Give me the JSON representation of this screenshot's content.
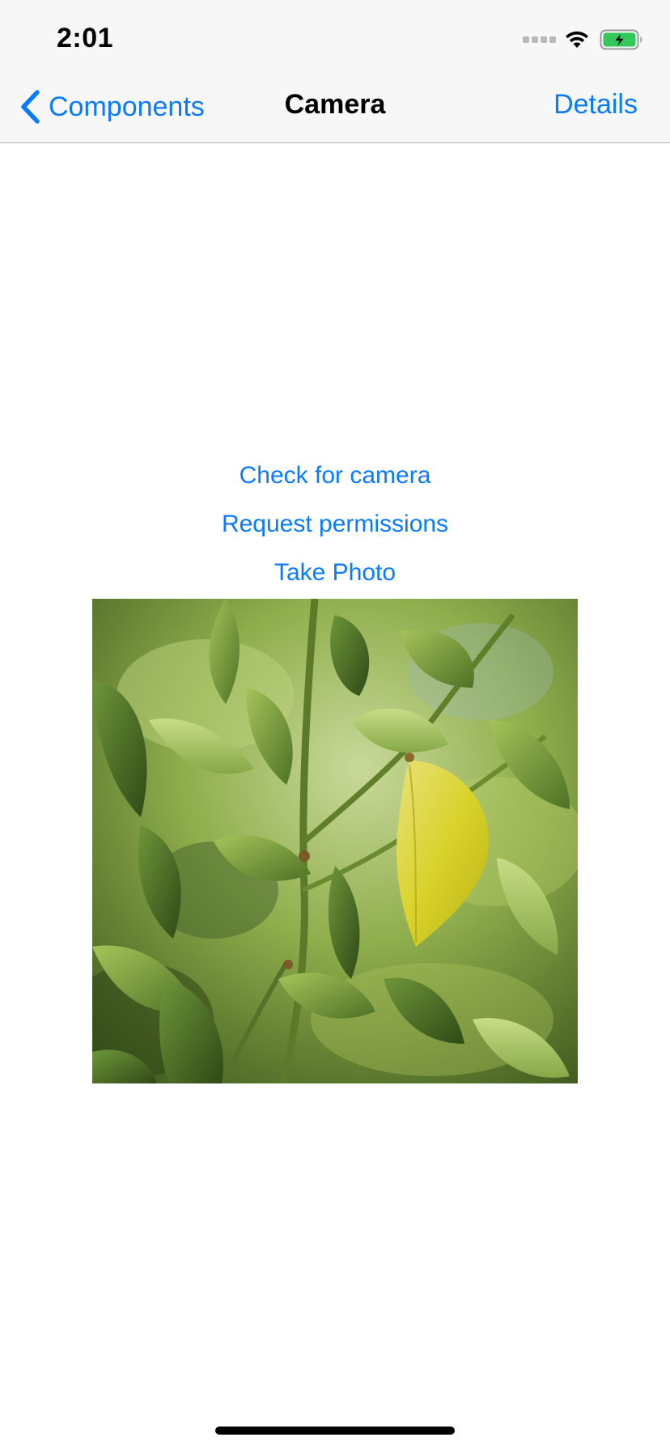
{
  "status_bar": {
    "time": "2:01",
    "icons": [
      "cellular-signal-icon",
      "wifi-icon",
      "battery-charging-icon"
    ],
    "battery_color": "#34c759"
  },
  "nav": {
    "back_label": "Components",
    "title": "Camera",
    "right_label": "Details",
    "back_icon": "chevron-left-icon",
    "accent_color": "#0a7aff"
  },
  "actions": {
    "check_camera": "Check for camera",
    "request_permissions": "Request permissions",
    "take_photo": "Take Photo"
  },
  "photo": {
    "subject": "green leaves with a yellow leaf",
    "icon": "photo-image"
  }
}
